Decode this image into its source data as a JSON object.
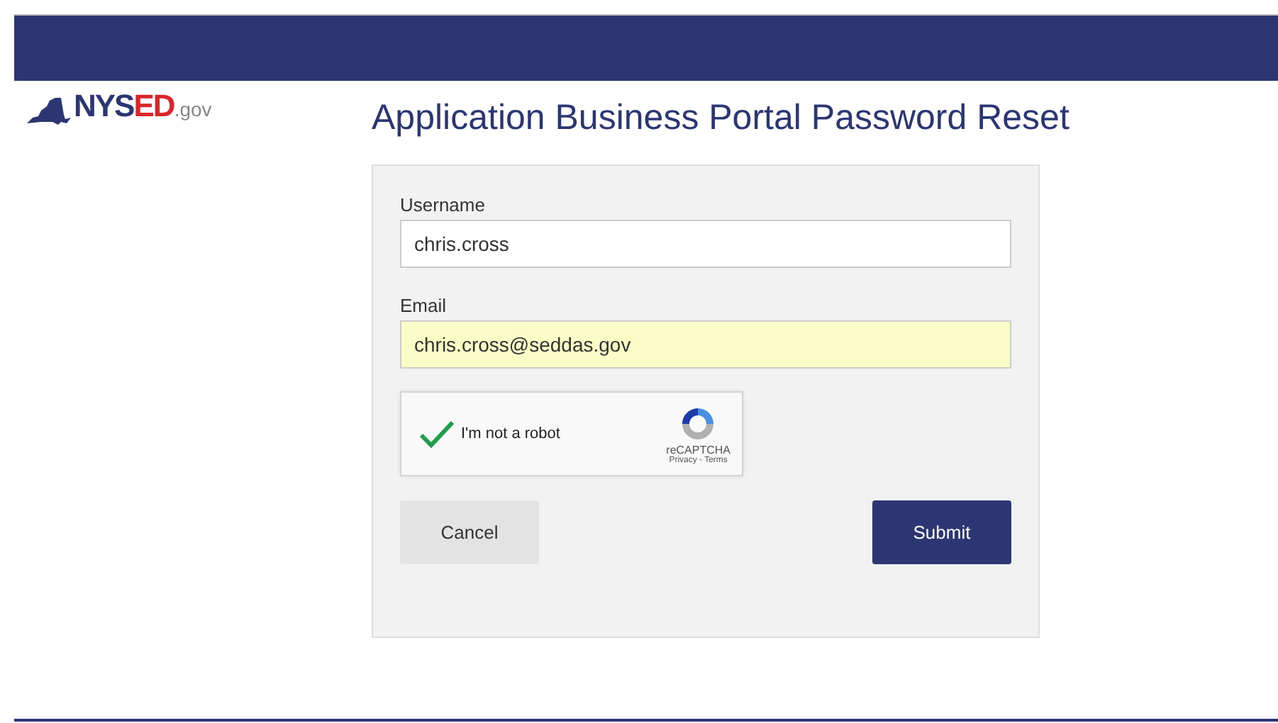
{
  "logo": {
    "parts": [
      {
        "text": "NYS",
        "kind": "primary"
      },
      {
        "text": "ED",
        "kind": "accent"
      },
      {
        "text": ".gov",
        "kind": "suffix"
      }
    ]
  },
  "title": "Application Business Portal Password Reset",
  "form": {
    "fields": [
      {
        "label": "Username",
        "value": "chris.cross",
        "autofilled": false
      },
      {
        "label": "Email",
        "value": "chris.cross@seddas.gov",
        "autofilled": true
      }
    ],
    "captcha": {
      "label": "I'm not a robot",
      "checked": true,
      "brand": "reCAPTCHA",
      "links": "Privacy - Terms"
    },
    "buttons": [
      {
        "label": "Cancel",
        "kind": "secondary"
      },
      {
        "label": "Submit",
        "kind": "primary"
      }
    ]
  }
}
